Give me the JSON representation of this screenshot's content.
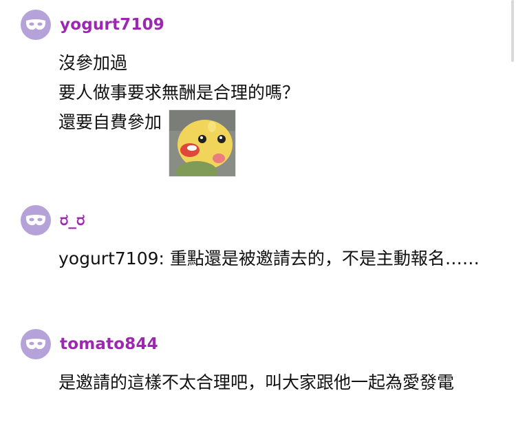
{
  "colors": {
    "username": "#9c27b0",
    "avatar_bg": "#b5a2d9",
    "text": "#111111"
  },
  "comments": [
    {
      "avatar_icon": "mask-icon",
      "username": "yogurt7109",
      "lines": [
        "沒參加過",
        "要人做事要求無酬是合理的嗎？",
        "還要自費參加"
      ],
      "sticker_icon": "yellow-chick-sticker"
    },
    {
      "avatar_icon": "mask-icon",
      "username": "ರ_ರ",
      "lines": [
        "yogurt7109: 重點還是被邀請去的，不是主動報名……"
      ]
    },
    {
      "avatar_icon": "mask-icon",
      "username": "tomato844",
      "lines": [
        "是邀請的這樣不太合理吧，叫大家跟他一起為愛發電"
      ]
    }
  ]
}
